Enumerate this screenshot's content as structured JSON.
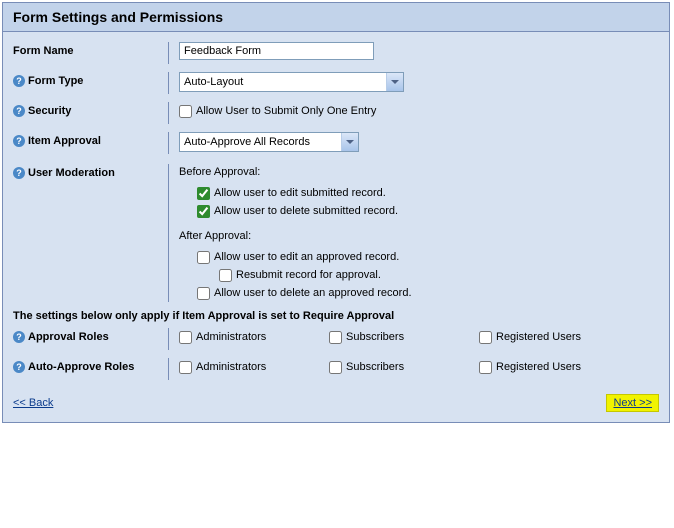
{
  "header": {
    "title": "Form Settings and Permissions"
  },
  "labels": {
    "form_name": "Form Name",
    "form_type": "Form Type",
    "security": "Security",
    "item_approval": "Item Approval",
    "user_moderation": "User Moderation",
    "approval_roles": "Approval Roles",
    "auto_approve_roles": "Auto-Approve Roles"
  },
  "values": {
    "form_name": "Feedback Form",
    "form_type": "Auto-Layout",
    "item_approval": "Auto-Approve All Records"
  },
  "security": {
    "submit_one": "Allow User to Submit Only One Entry"
  },
  "moderation": {
    "before_title": "Before Approval:",
    "after_title": "After Approval:",
    "edit_submitted": "Allow user to edit submitted record.",
    "delete_submitted": "Allow user to delete submitted record.",
    "edit_approved": "Allow user to edit an approved record.",
    "resubmit": "Resubmit record for approval.",
    "delete_approved": "Allow user to delete an approved record."
  },
  "note": "The settings below only apply if Item Approval is set to Require Approval",
  "roles": {
    "admins": "Administrators",
    "subscribers": "Subscribers",
    "registered": "Registered Users"
  },
  "footer": {
    "back": "<< Back",
    "next": "Next >>"
  }
}
